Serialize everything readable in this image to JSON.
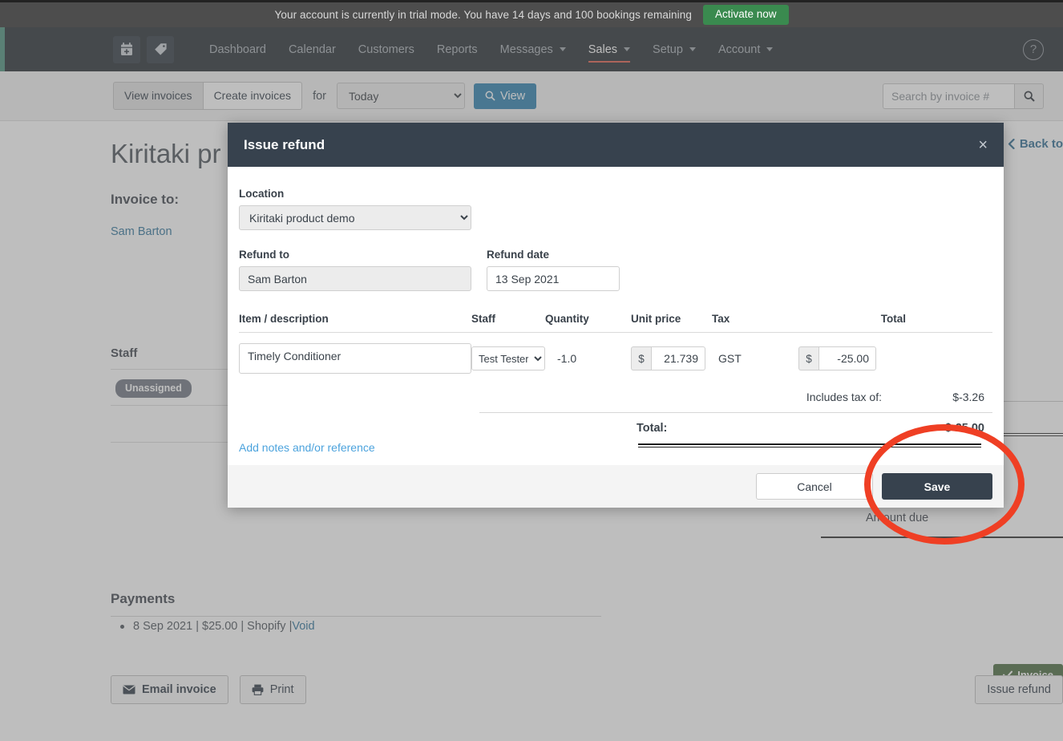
{
  "banner": {
    "text": "Your account is currently in trial mode. You have 14 days and 100 bookings remaining",
    "activate_label": "Activate now",
    "bg_color": "#4d4d4d",
    "activate_color": "#3a8a4f"
  },
  "nav": {
    "icons": [
      {
        "name": "calendar-plus-icon",
        "label": "calendar-plus"
      },
      {
        "name": "tag-icon",
        "label": "tag"
      }
    ],
    "items": [
      {
        "label": "Dashboard",
        "caret": false,
        "active": false
      },
      {
        "label": "Calendar",
        "caret": false,
        "active": false
      },
      {
        "label": "Customers",
        "caret": false,
        "active": false
      },
      {
        "label": "Reports",
        "caret": false,
        "active": false
      },
      {
        "label": "Messages",
        "caret": true,
        "active": false
      },
      {
        "label": "Sales",
        "caret": true,
        "active": true
      },
      {
        "label": "Setup",
        "caret": true,
        "active": false
      },
      {
        "label": "Account",
        "caret": true,
        "active": false
      }
    ],
    "help_label": "?",
    "bg_color": "#242b31",
    "active_underline_color": "#e05c4b"
  },
  "toolbar": {
    "view_invoices_label": "View invoices",
    "create_invoices_label": "Create invoices",
    "for_label": "for",
    "date_selected": "Today",
    "date_options": [
      "Today"
    ],
    "view_button_label": "View",
    "view_button_color": "#2b7fad",
    "search_placeholder": "Search by invoice #",
    "search_value": ""
  },
  "page": {
    "title": "Kiritaki pr",
    "back_link": "Back to",
    "invoice_to_label": "Invoice to:",
    "customer_name": "Sam Barton",
    "staff_heading": "Staff",
    "unassigned_badge": "Unassigned",
    "amount_due_label": "Amount due",
    "invoice_badge": "Invoice",
    "payments_heading": "Payments",
    "payment_entry": "8 Sep 2021 | $25.00 | Shopify | ",
    "payment_void_link": "Void",
    "email_invoice_label": "Email invoice",
    "print_label": "Print",
    "issue_refund_label": "Issue refund"
  },
  "modal": {
    "title": "Issue refund",
    "close_label": "×",
    "header_color": "#37424e",
    "location_label": "Location",
    "location_value": "Kiritaki product demo",
    "location_options": [
      "Kiritaki product demo"
    ],
    "refund_to_label": "Refund to",
    "refund_to_value": "Sam Barton",
    "refund_date_label": "Refund date",
    "refund_date_value": "13 Sep 2021",
    "columns": {
      "item": "Item / description",
      "staff": "Staff",
      "quantity": "Quantity",
      "unit_price": "Unit price",
      "tax": "Tax",
      "total": "Total"
    },
    "line_item": {
      "description": "Timely Conditioner",
      "staff_value": "Test Tester",
      "staff_options": [
        "Test Tester"
      ],
      "quantity": "-1.0",
      "currency_symbol": "$",
      "unit_price": "21.739",
      "tax": "GST",
      "total": "-25.00"
    },
    "includes_tax_label": "Includes tax of:",
    "includes_tax_value": "$-3.26",
    "total_label": "Total:",
    "total_value": "$-25.00",
    "notes_link": "Add notes and/or reference",
    "cancel_label": "Cancel",
    "save_label": "Save"
  },
  "annotation": {
    "shape": "ellipse",
    "color": "#ef3f24",
    "target": "save-button"
  }
}
